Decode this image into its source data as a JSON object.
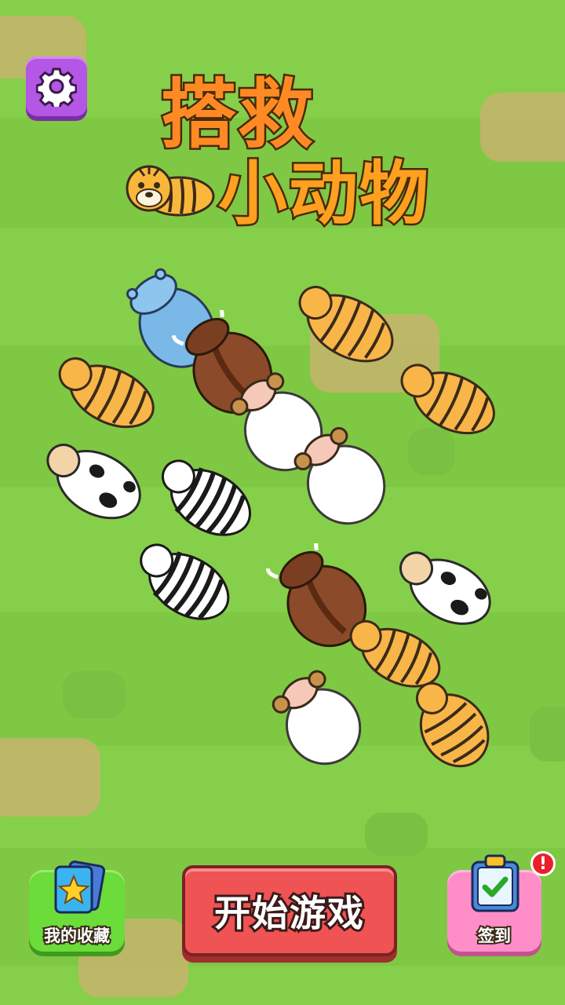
{
  "title": {
    "line1": "搭救",
    "line2": "小动物"
  },
  "settings": {
    "icon": "gear-icon"
  },
  "buttons": {
    "collection": {
      "label": "我的收藏",
      "icon": "star-cards-icon"
    },
    "start": {
      "label": "开始游戏"
    },
    "checkin": {
      "label": "签到",
      "icon": "clipboard-check-icon",
      "badge": "!"
    }
  },
  "animals": [
    "hippo",
    "tiger",
    "tiger",
    "tiger",
    "tiger",
    "tiger",
    "tiger",
    "bison",
    "bison",
    "sheep",
    "sheep",
    "sheep",
    "cow",
    "cow",
    "zebra",
    "zebra"
  ],
  "colors": {
    "grass": "#86cf4a",
    "start_button": "#ef5354",
    "settings_button": "#b456e6",
    "collection_button": "#6bdc3a",
    "checkin_button": "#ff8ec8"
  }
}
